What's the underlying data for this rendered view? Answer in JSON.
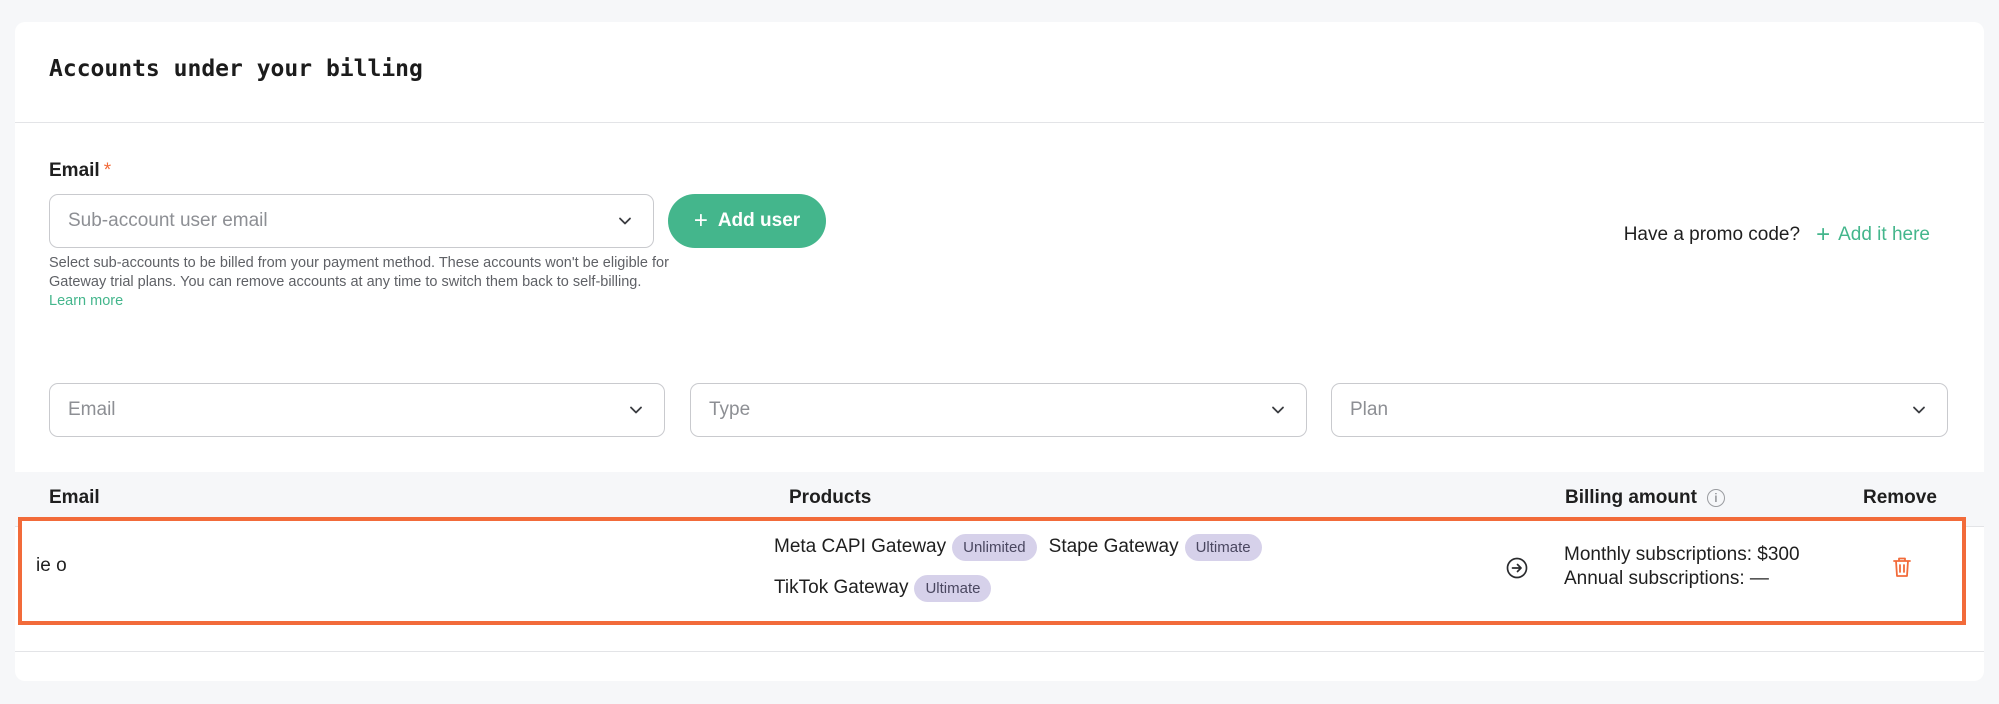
{
  "section": {
    "title": "Accounts under your billing"
  },
  "add_form": {
    "email_label": "Email",
    "required_mark": "*",
    "email_placeholder": "Sub-account user email",
    "add_button_label": "Add user",
    "help_text": "Select sub-accounts to be billed from your payment method. These accounts won't be eligible for Gateway trial plans. You can remove accounts at any time to switch them back to self-billing.",
    "learn_more": "Learn more"
  },
  "promo": {
    "question": "Have a promo code?",
    "link_label": "Add it here"
  },
  "filters": {
    "email_placeholder": "Email",
    "type_placeholder": "Type",
    "plan_placeholder": "Plan"
  },
  "table": {
    "columns": {
      "email": "Email",
      "products": "Products",
      "billing": "Billing amount",
      "remove": "Remove"
    },
    "rows": [
      {
        "email": "ie                                    o",
        "products": [
          {
            "name": "Meta CAPI Gateway",
            "plan": "Unlimited"
          },
          {
            "name": "Stape Gateway",
            "plan": "Ultimate"
          },
          {
            "name": "TikTok Gateway",
            "plan": "Ultimate"
          }
        ],
        "billing_monthly": "Monthly subscriptions: $300",
        "billing_annual": "Annual subscriptions: —"
      }
    ]
  },
  "colors": {
    "accent": "#44b68c",
    "highlight": "#f26b3a",
    "badge_bg": "#d6d1ea"
  }
}
